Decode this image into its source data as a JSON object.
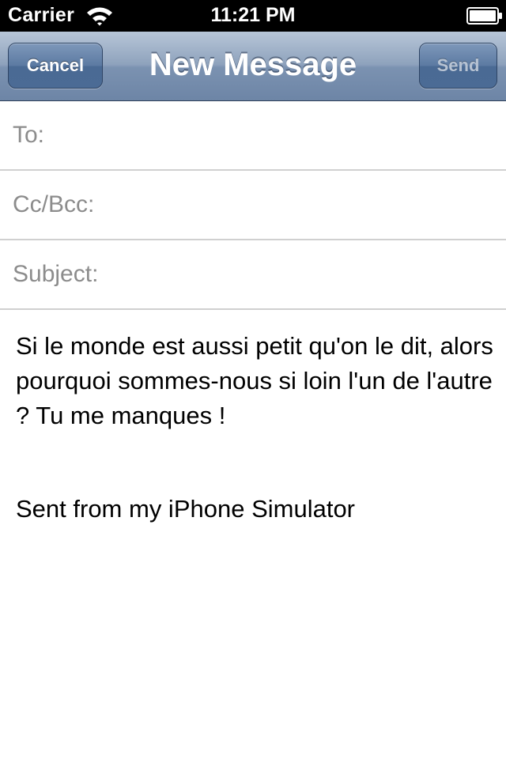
{
  "status_bar": {
    "carrier": "Carrier",
    "time": "11:21 PM"
  },
  "nav_bar": {
    "title": "New Message",
    "cancel_label": "Cancel",
    "send_label": "Send",
    "send_enabled": false
  },
  "fields": {
    "to_label": "To:",
    "cc_bcc_label": "Cc/Bcc:",
    "subject_label": "Subject:"
  },
  "body": {
    "text": "Si le monde est aussi petit qu'on le dit, alors pourquoi sommes-nous si loin l'un de l'autre ? Tu me manques !",
    "signature": "Sent from my iPhone Simulator"
  },
  "colors": {
    "nav_bar": "#7b92b1",
    "label_gray": "#8c8c8c",
    "separator": "#d0d0d0"
  },
  "icons": {
    "wifi": "wifi-icon",
    "battery": "battery-icon"
  }
}
